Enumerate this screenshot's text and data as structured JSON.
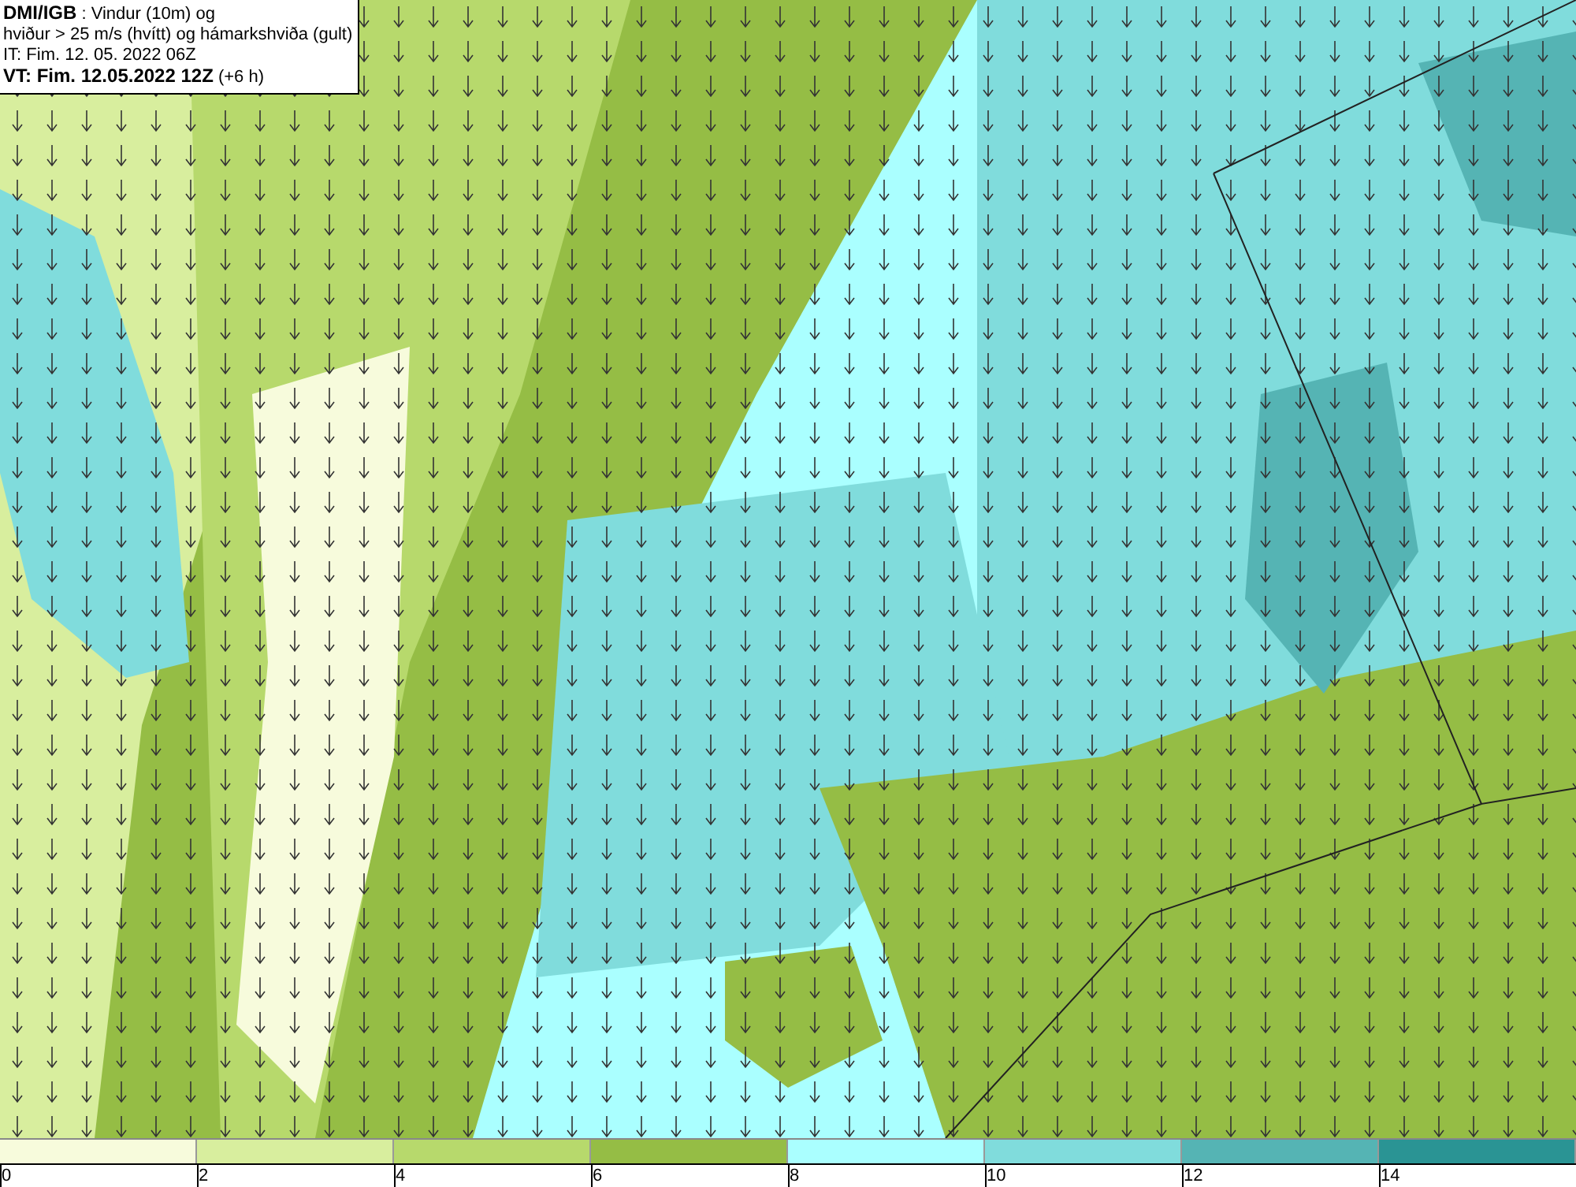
{
  "info_box": {
    "lines": [
      "**DMI/IGB** : Vindur (10m) og",
      "hviður > 25 m/s (hvítt) og hámarkshviða (gult)",
      "IT: Fim. 12. 05. 2022 06Z",
      "**VT: Fim. 12.05.2022 12Z** (+6 h)"
    ]
  },
  "legend": {
    "bins": [
      {
        "label": "0",
        "color": "#f7fbdc"
      },
      {
        "label": "2",
        "color": "#d8ee9e"
      },
      {
        "label": "4",
        "color": "#b7d96c"
      },
      {
        "label": "6",
        "color": "#95bd45"
      },
      {
        "label": "8",
        "color": "#aaffff"
      },
      {
        "label": "10",
        "color": "#80dcdc"
      },
      {
        "label": "12",
        "color": "#55b4b4"
      },
      {
        "label": "14",
        "color": "#2a9494"
      }
    ]
  }
}
